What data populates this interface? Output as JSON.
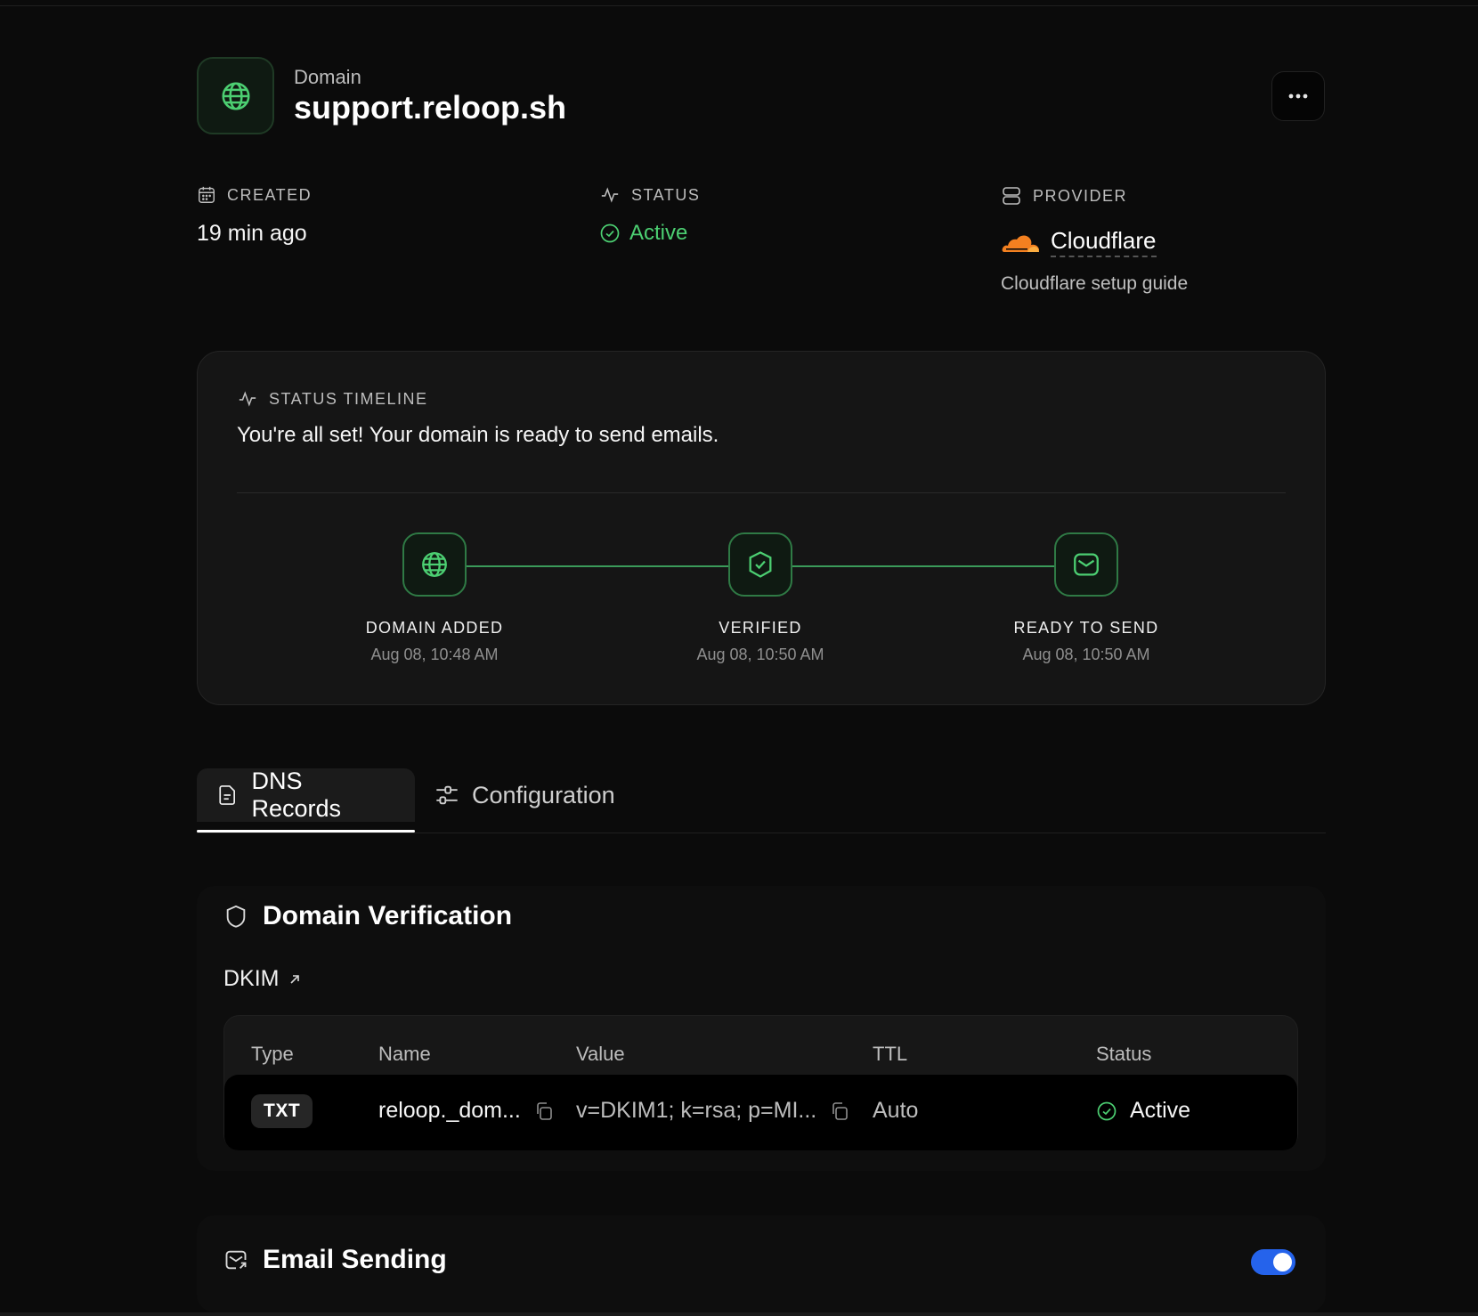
{
  "header": {
    "label": "Domain",
    "domain": "support.reloop.sh"
  },
  "meta": {
    "created_label": "CREATED",
    "created_value": "19 min ago",
    "status_label": "STATUS",
    "status_value": "Active",
    "provider_label": "PROVIDER",
    "provider_name": "Cloudflare",
    "provider_guide": "Cloudflare setup guide"
  },
  "timeline": {
    "heading": "STATUS TIMELINE",
    "message": "You're all set! Your domain is ready to send emails.",
    "steps": [
      {
        "title": "DOMAIN ADDED",
        "time": "Aug 08, 10:48 AM",
        "icon": "globe-icon"
      },
      {
        "title": "VERIFIED",
        "time": "Aug 08, 10:50 AM",
        "icon": "shield-check-icon"
      },
      {
        "title": "READY TO SEND",
        "time": "Aug 08, 10:50 AM",
        "icon": "mail-icon"
      }
    ]
  },
  "tabs": [
    {
      "label": "DNS Records",
      "active": true
    },
    {
      "label": "Configuration",
      "active": false
    }
  ],
  "verification": {
    "title": "Domain Verification",
    "dkim_label": "DKIM",
    "columns": [
      "Type",
      "Name",
      "Value",
      "TTL",
      "Status"
    ],
    "row": {
      "type": "TXT",
      "name": "reloop._dom...",
      "value": "v=DKIM1; k=rsa; p=MI...",
      "ttl": "Auto",
      "status": "Active"
    }
  },
  "sending": {
    "title": "Email Sending",
    "enabled": true
  },
  "colors": {
    "background": "#0b0b0b",
    "accent_green": "#4ccf72",
    "toggle_blue": "#2563eb",
    "cloudflare_orange": "#f38020"
  }
}
